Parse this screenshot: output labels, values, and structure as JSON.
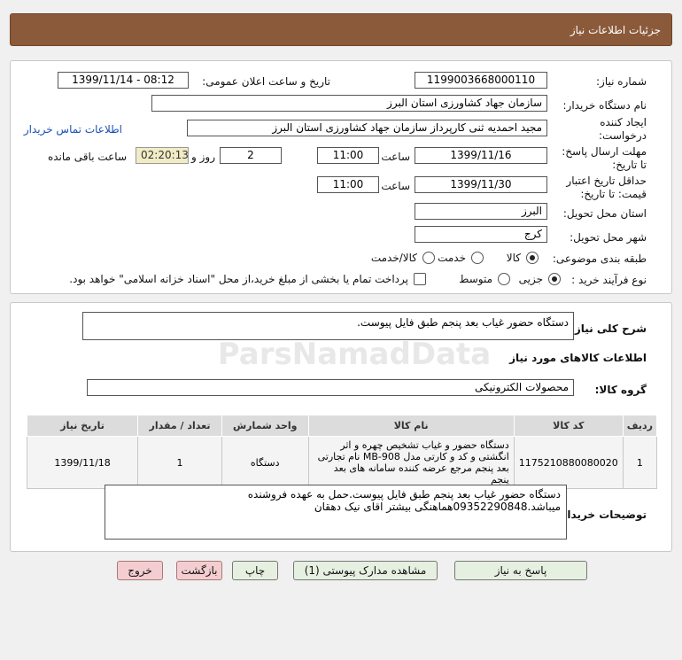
{
  "header": {
    "title": "جزئیات اطلاعات نیاز"
  },
  "form": {
    "need_number_label": "شماره نیاز:",
    "need_number": "1199003668000110",
    "announce_label": "تاریخ و ساعت اعلان عمومی:",
    "announce_value": "1399/11/14 - 08:12",
    "buyer_org_label": "نام دستگاه خریدار:",
    "buyer_org": "سازمان جهاد کشاورزی استان البرز",
    "creator_label_1": "ایجاد کننده",
    "creator_label_2": "درخواست:",
    "creator": "مجید احمدیه ثنی کارپرداز سازمان جهاد کشاورزی استان البرز",
    "contact_link": "اطلاعات تماس خریدار",
    "deadline_label_1": "مهلت ارسال پاسخ:",
    "deadline_label_2": "تا تاریخ:",
    "deadline_date": "1399/11/16",
    "time_label": "ساعت",
    "deadline_time": "11:00",
    "days_value": "2",
    "days_label": "روز و",
    "timer_value": "02:20:13",
    "remaining_label": "ساعت باقی مانده",
    "validity_label_1": "حداقل تاریخ اعتبار",
    "validity_label_2": "قیمت: تا تاریخ:",
    "validity_date": "1399/11/30",
    "validity_time": "11:00",
    "province_label": "استان محل تحویل:",
    "province": "البرز",
    "city_label": "شهر محل تحویل:",
    "city": "کرج",
    "category_label": "طبقه بندی موضوعی:",
    "cat_goods": "کالا",
    "cat_service": "خدمت",
    "cat_goods_service": "کالا/خدمت",
    "process_label": "نوع فرآیند خرید :",
    "proc_partial": "جزیی",
    "proc_medium": "متوسط",
    "payment_note": "پرداخت تمام یا بخشی از مبلغ خرید،از محل \"اسناد خزانه اسلامی\" خواهد بود."
  },
  "details": {
    "summary_label": "شرح کلی نیاز:",
    "summary": "دستگاه حضور غیاب بعد پنجم طبق فایل پیوست.",
    "goods_info_title": "اطلاعات کالاهای مورد نیاز",
    "group_label": "گروه کالا:",
    "group": "محصولات الکترونیکی",
    "table": {
      "headers": [
        "ردیف",
        "کد کالا",
        "نام کالا",
        "واحد شمارش",
        "تعداد / مقدار",
        "تاریخ نیاز"
      ],
      "rows": [
        {
          "row": "1",
          "code": "1175210880080020",
          "name": "دستگاه حضور و غیاب تشخیص چهره و اثر انگشتی و کد و کارتی مدل MB-908 نام تجارتی بعد پنجم مرجع عرضه کننده سامانه های بعد پنجم",
          "unit": "دستگاه",
          "qty": "1",
          "date": "1399/11/18"
        }
      ]
    },
    "buyer_notes_label": "توضیحات خریدار:",
    "buyer_notes": "دستگاه حضور غیاب بعد پنجم طبق فایل پیوست.حمل به عهده فروشنده میباشد.09352290848هماهنگی بیشتر اقای نیک دهقان"
  },
  "buttons": {
    "reply": "پاسخ به نیاز",
    "attachments": "مشاهده مدارک پیوستی (1)",
    "print": "چاپ",
    "back": "بازگشت",
    "exit": "خروج"
  },
  "watermark": "ParsNamadData",
  "colors": {
    "header_bg": "#8b5a3a",
    "link": "#1a4fb5",
    "timer_bg": "#f2ecc6",
    "exit_button": "#f4cdd0"
  }
}
